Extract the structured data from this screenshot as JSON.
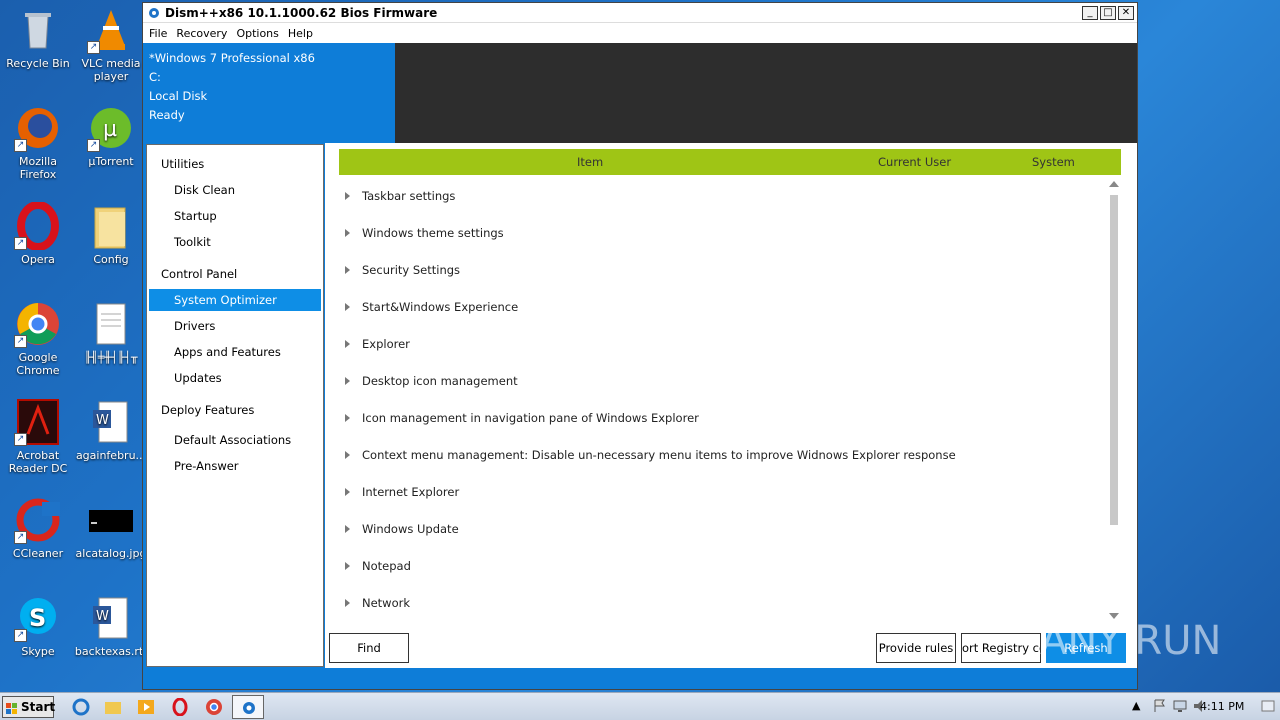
{
  "desktop": {
    "icons": [
      {
        "label": "Recycle Bin",
        "icon": "recycle-bin-icon"
      },
      {
        "label": "VLC media player",
        "icon": "vlc-icon"
      },
      {
        "label": "Mozilla Firefox",
        "icon": "firefox-icon"
      },
      {
        "label": "µTorrent",
        "icon": "utorrent-icon"
      },
      {
        "label": "Opera",
        "icon": "opera-icon"
      },
      {
        "label": "Config",
        "icon": "folder-icon"
      },
      {
        "label": "Google Chrome",
        "icon": "chrome-icon"
      },
      {
        "label": "╟╢╪╫┤╟┤╥",
        "icon": "text-file-icon"
      },
      {
        "label": "Acrobat Reader DC",
        "icon": "acrobat-icon"
      },
      {
        "label": "againfebru...",
        "icon": "word-doc-icon"
      },
      {
        "label": "CCleaner",
        "icon": "ccleaner-icon"
      },
      {
        "label": "alcatalog.jpg",
        "icon": "image-file-icon"
      },
      {
        "label": "Skype",
        "icon": "skype-icon"
      },
      {
        "label": "backtexas.rtf",
        "icon": "word-doc-icon"
      }
    ]
  },
  "window": {
    "title": "Dism++x86 10.1.1000.62 Bios Firmware",
    "controls": {
      "minimize": "_",
      "maximize": "□",
      "close": "✕"
    },
    "menu": [
      "File",
      "Recovery",
      "Options",
      "Help"
    ],
    "info": {
      "os": "*Windows 7 Professional x86",
      "drive": "C:",
      "disk": "Local Disk",
      "status": "Ready"
    },
    "sidebar": {
      "groups": [
        {
          "label": "Utilities",
          "items": [
            "Disk Clean",
            "Startup",
            "Toolkit"
          ]
        },
        {
          "label": "Control Panel",
          "items": [
            "System Optimizer",
            "Drivers",
            "Apps and Features",
            "Updates"
          ]
        },
        {
          "label": "Deploy Features",
          "items": [
            "Default Associations",
            "Pre-Answer"
          ]
        }
      ],
      "active": "System Optimizer"
    },
    "grid": {
      "columns": [
        "Item",
        "Current User",
        "System"
      ],
      "rows": [
        "Taskbar settings",
        "Windows theme settings",
        "Security Settings",
        "Start&Windows Experience",
        "Explorer",
        "Desktop icon management",
        "Icon management in navigation pane of Windows Explorer",
        "Context menu management: Disable un-necessary menu items to improve Widnows Explorer response",
        "Internet Explorer",
        "Windows Update",
        "Notepad",
        "Network"
      ]
    },
    "buttons": {
      "find": "Find",
      "provide_rules": "Provide rules",
      "import_registry": "ort Registry co",
      "refresh": "Refresh"
    },
    "accent": "#0e7dd8",
    "grid_header_color": "#9fc515"
  },
  "watermark": "ANY RUN",
  "taskbar": {
    "start": "Start",
    "clock": "4:11 PM"
  }
}
